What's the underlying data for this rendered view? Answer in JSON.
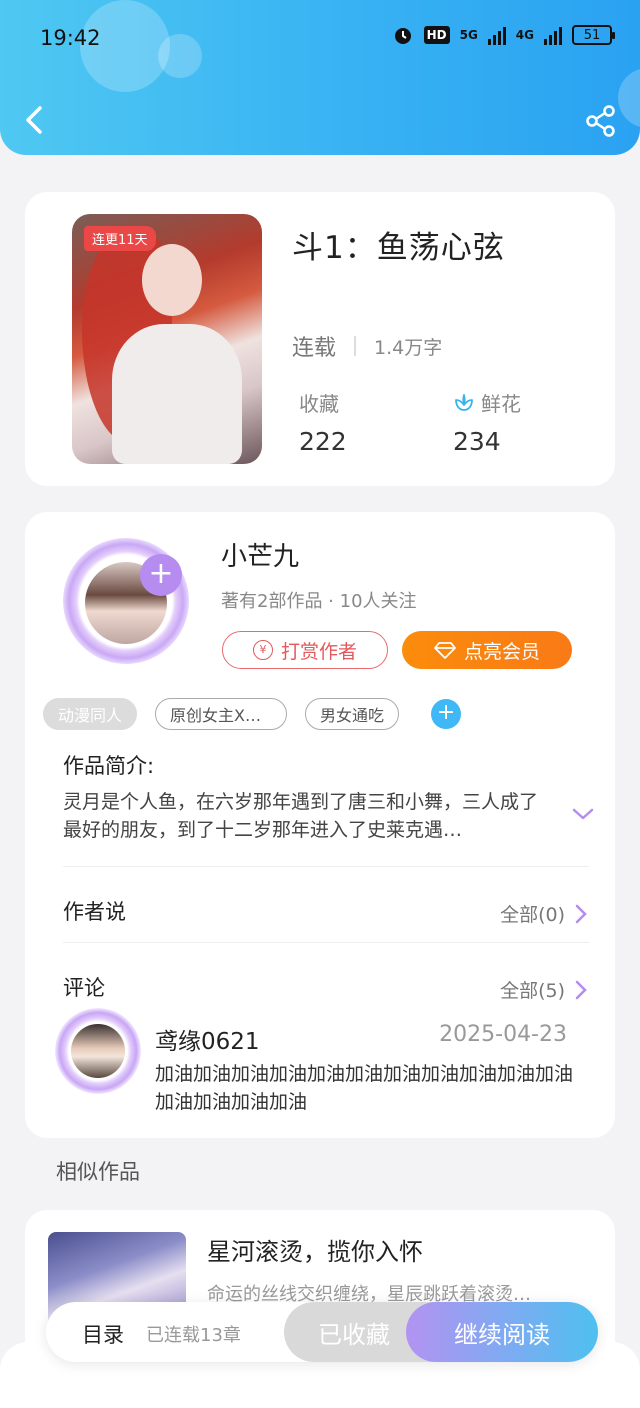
{
  "status_bar": {
    "time": "19:42",
    "hd": "HD",
    "net1": "5G",
    "net2": "4G",
    "battery": "51"
  },
  "header": {
    "back_icon": "chevron-left-icon",
    "share_icon": "share-icon"
  },
  "book": {
    "cover_badge": "连更11天",
    "title": "斗1：鱼荡心弦",
    "status": "连载",
    "word_count": "1.4万字",
    "favorites_label": "收藏",
    "favorites_value": "222",
    "flowers_label": "鲜花",
    "flowers_value": "234"
  },
  "author": {
    "name": "小芒九",
    "meta": "著有2部作品 · 10人关注",
    "follow_symbol": "+",
    "tip_label": "打赏作者",
    "tip_coin": "¥",
    "vip_label": "点亮会员"
  },
  "tags": [
    "动漫同人",
    "原创女主X…",
    "男女通吃"
  ],
  "tag_add_symbol": "+",
  "intro": {
    "title": "作品简介:",
    "text": "灵月是个人鱼，在六岁那年遇到了唐三和小舞，三人成了最好的朋友，到了十二岁那年进入了史莱克遇…"
  },
  "author_says": {
    "title": "作者说",
    "more": "全部(0)"
  },
  "comments": {
    "title": "评论",
    "more": "全部(5)",
    "items": [
      {
        "user": "鸢缘0621",
        "date": "2025-04-23",
        "text": "加油加油加油加油加油加油加油加油加油加油加油加油加油加油加油"
      }
    ]
  },
  "similar": {
    "title": "相似作品",
    "items": [
      {
        "title": "星河滚烫，揽你入怀",
        "desc": "命运的丝线交织缠绕，星辰跳跃着滚烫…"
      }
    ]
  },
  "bottom_bar": {
    "toc": "目录",
    "chapter_count": "已连载13章",
    "favorite_btn": "已收藏",
    "read_btn": "继续阅读"
  },
  "colors": {
    "accent": "#38b2f3",
    "vip": "#fb8c0c",
    "tip": "#e5585c",
    "follow": "#b68cf0"
  }
}
